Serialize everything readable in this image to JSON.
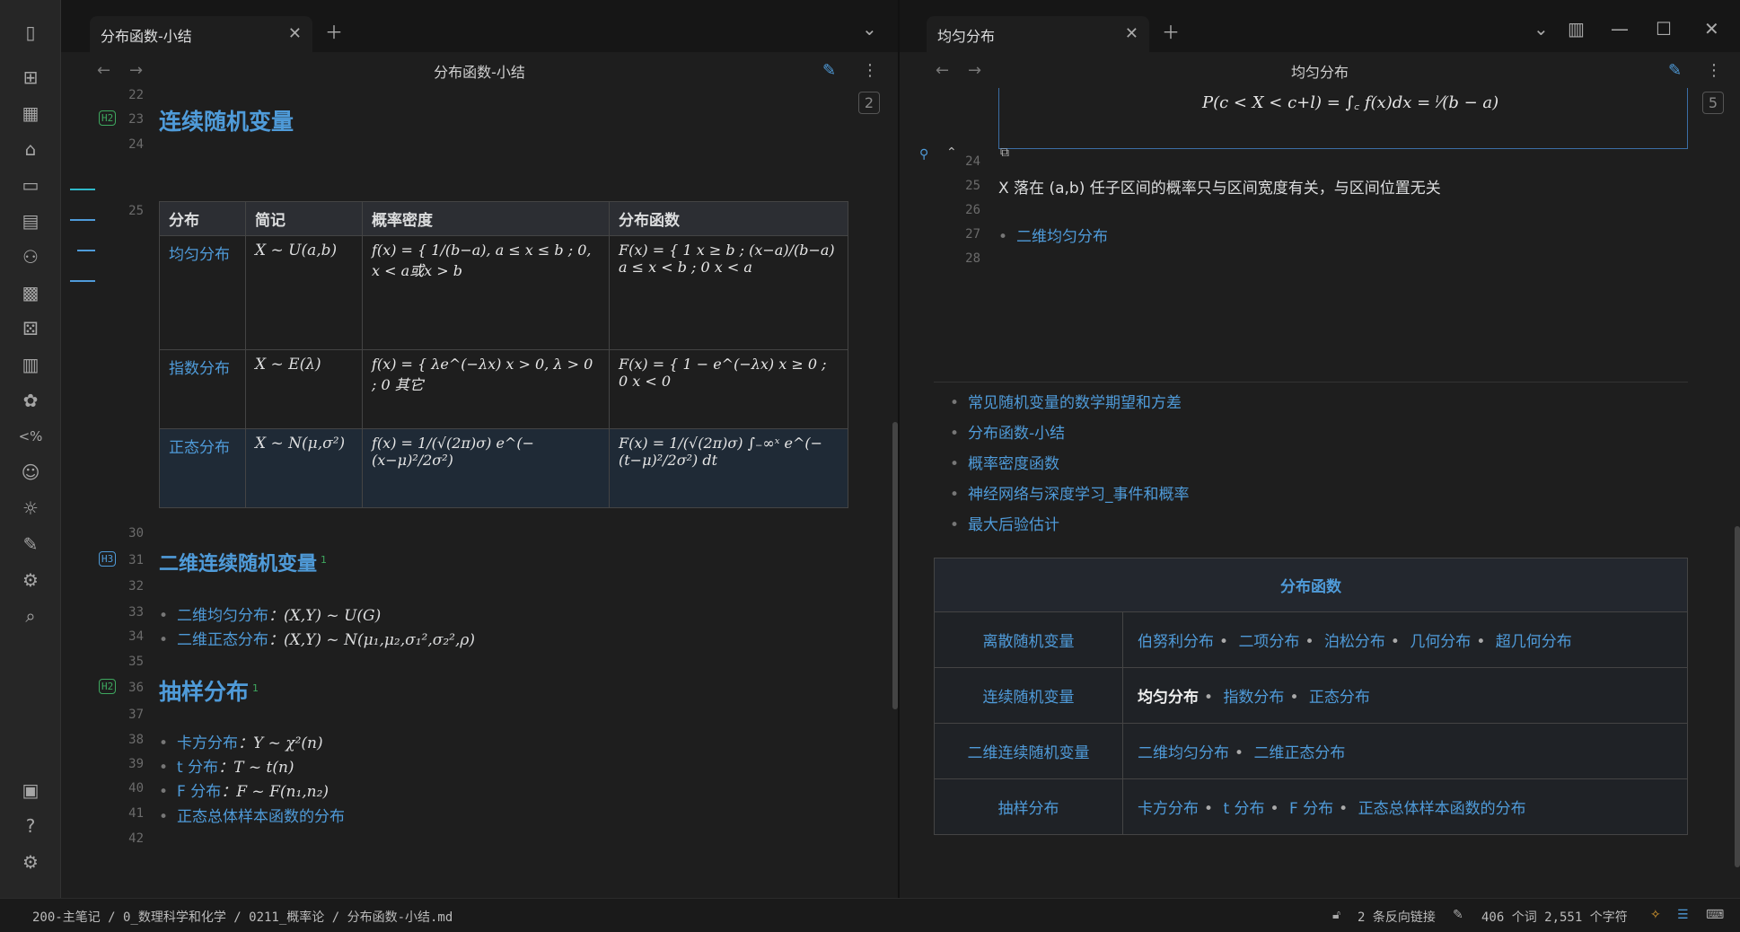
{
  "left_tab": {
    "title": "分布函数-小结"
  },
  "right_tab": {
    "title": "均匀分布"
  },
  "left_header": {
    "title": "分布函数-小结"
  },
  "right_header": {
    "title": "均匀分布"
  },
  "left_content": {
    "line_numbers": [
      "22",
      "23",
      "24",
      "25",
      "30",
      "31",
      "32",
      "33",
      "34",
      "35",
      "36",
      "37",
      "38",
      "39",
      "40",
      "41",
      "42"
    ],
    "h2_continuous": "连续随机变量",
    "table": {
      "headers": [
        "分布",
        "简记",
        "概率密度",
        "分布函数"
      ],
      "rows": [
        {
          "name": "均匀分布",
          "notation": "X ~ U(a,b)",
          "pdf": "f(x) = { 1/(b−a),  a ≤ x ≤ b ; 0,  x < a或x > b",
          "cdf": "F(x) = { 1  x ≥ b ; (x−a)/(b−a)  a ≤ x < b ; 0  x < a"
        },
        {
          "name": "指数分布",
          "notation": "X ~ E(λ)",
          "pdf": "f(x) = { λe^(−λx)  x > 0, λ > 0 ; 0  其它",
          "cdf": "F(x) = { 1 − e^(−λx)  x ≥ 0 ; 0  x < 0"
        },
        {
          "name": "正态分布",
          "notation": "X ~ N(μ,σ²)",
          "pdf": "f(x) = 1/(√(2π)σ) e^(−(x−μ)²/2σ²)",
          "cdf": "F(x) = 1/(√(2π)σ) ∫₋∞ˣ e^(−(t−μ)²/2σ²) dt"
        }
      ]
    },
    "h3_2d": "二维连续随机变量",
    "h3_2d_sup": "1",
    "bullets_2d": [
      {
        "link": "二维均匀分布",
        "formula": "：(X,Y) ~ U(G)"
      },
      {
        "link": "二维正态分布",
        "formula": "：(X,Y) ~ N(μ₁,μ₂,σ₁²,σ₂²,ρ)"
      }
    ],
    "h2_sampling": "抽样分布",
    "h2_sampling_sup": "1",
    "bullets_sampling": [
      {
        "link": "卡方分布",
        "formula": "：Y ~ χ²(n)"
      },
      {
        "link": "t 分布",
        "formula": "：T ~ t(n)"
      },
      {
        "link": "F 分布",
        "formula": "：F ~ F(n₁,n₂)"
      },
      {
        "link": "正态总体样本函数的分布",
        "formula": ""
      }
    ],
    "page_badge": "2"
  },
  "right_content": {
    "top_formula": "P(c < X < c+l) = ∫꜀ f(x)dx = ˡ⁄(b − a)",
    "page_badge": "5",
    "line_numbers": [
      "24",
      "25",
      "26",
      "27",
      "28"
    ],
    "line25_text": "X 落在 (a,b) 任子区间的概率只与区间宽度有关，与区间位置无关",
    "line27_link": "二维均匀分布",
    "related_links": [
      "常见随机变量的数学期望和方差",
      "分布函数-小结",
      "概率密度函数",
      "神经网络与深度学习_事件和概率",
      "最大后验估计"
    ],
    "nav_table": {
      "header": "分布函数",
      "rows": [
        {
          "category": "离散随机变量",
          "items": [
            "伯努利分布",
            "二项分布",
            "泊松分布",
            "几何分布",
            "超几何分布"
          ]
        },
        {
          "category": "连续随机变量",
          "items": [
            "均匀分布",
            "指数分布",
            "正态分布"
          ]
        },
        {
          "category": "二维连续随机变量",
          "items": [
            "二维均匀分布",
            "二维正态分布"
          ]
        },
        {
          "category": "抽样分布",
          "items": [
            "卡方分布",
            "t 分布",
            "F 分布",
            "正态总体样本函数的分布"
          ]
        }
      ]
    }
  },
  "status_bar": {
    "breadcrumb": "200-主笔记 / 0_数理科学和化学 / 0211_概率论 / 分布函数-小结.md",
    "backlinks": "2 条反向链接",
    "word_count": "406 个词 2,551 个字符"
  },
  "icons": {
    "add_tab": "plus-icon",
    "close_tab": "close-icon",
    "chevron": "chevron-down-icon",
    "edit": "edit-icon",
    "more": "more-vertical-icon"
  }
}
